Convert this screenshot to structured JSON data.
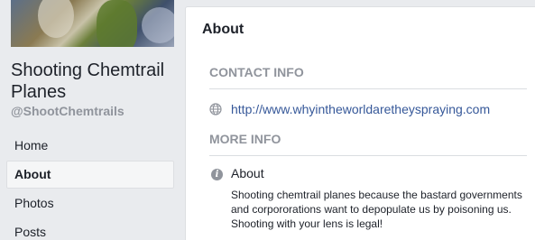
{
  "sidebar": {
    "page_name": "Shooting Chemtrail Planes",
    "handle": "@ShootChemtrails",
    "nav": [
      {
        "label": "Home",
        "active": false
      },
      {
        "label": "About",
        "active": true
      },
      {
        "label": "Photos",
        "active": false
      },
      {
        "label": "Posts",
        "active": false
      }
    ]
  },
  "main": {
    "title": "About",
    "contact_header": "CONTACT INFO",
    "website": "http://www.whyintheworldaretheyspraying.com",
    "more_header": "MORE INFO",
    "about_label": "About",
    "about_text": "Shooting chemtrail planes because the bastard governments and corpororations want to depopulate us by poisoning us. Shooting with your lens is legal!"
  },
  "icons": {
    "website": "globe-icon",
    "about": "info-icon"
  },
  "colors": {
    "background": "#e9ebee",
    "link": "#365899",
    "muted": "#90949c",
    "text": "#1d2129"
  }
}
